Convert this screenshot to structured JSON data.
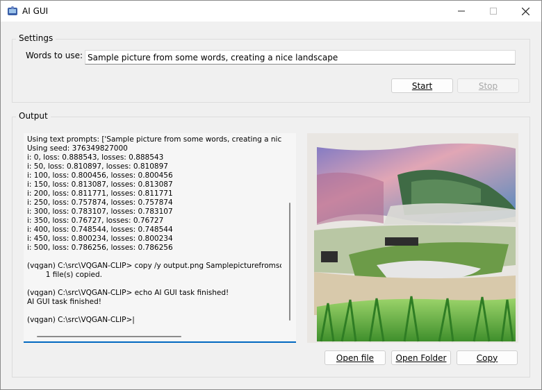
{
  "window": {
    "title": "AI GUI"
  },
  "settings": {
    "label": "Settings",
    "words_label": "Words to use:",
    "words_value": "Sample picture from some words, creating a nice landscape",
    "start_label": "Start",
    "stop_label": "Stop"
  },
  "output": {
    "label": "Output",
    "console_lines": [
      "Using text prompts: ['Sample picture from some words, creating a nice",
      "Using seed: 376349827000",
      "i: 0, loss: 0.888543, losses: 0.888543",
      "i: 50, loss: 0.810897, losses: 0.810897",
      "i: 100, loss: 0.800456, losses: 0.800456",
      "i: 150, loss: 0.813087, losses: 0.813087",
      "i: 200, loss: 0.811771, losses: 0.811771",
      "i: 250, loss: 0.757874, losses: 0.757874",
      "i: 300, loss: 0.783107, losses: 0.783107",
      "i: 350, loss: 0.76727, losses: 0.76727",
      "i: 400, loss: 0.748544, losses: 0.748544",
      "i: 450, loss: 0.800234, losses: 0.800234",
      "i: 500, loss: 0.786256, losses: 0.786256",
      "",
      "(vqgan) C:\\src\\VQGAN-CLIP> copy /y output.png Samplepicturefromsom",
      "        1 file(s) copied.",
      "",
      "(vqgan) C:\\src\\VQGAN-CLIP> echo AI GUI task finished!",
      "AI GUI task finished!",
      "",
      "(vqgan) C:\\src\\VQGAN-CLIP>|"
    ],
    "open_file_label": "Open file",
    "open_folder_label": "Open Folder",
    "copy_label": "Copy"
  },
  "colors": {
    "accent": "#0067c0",
    "window_bg": "#f0f0f0"
  }
}
